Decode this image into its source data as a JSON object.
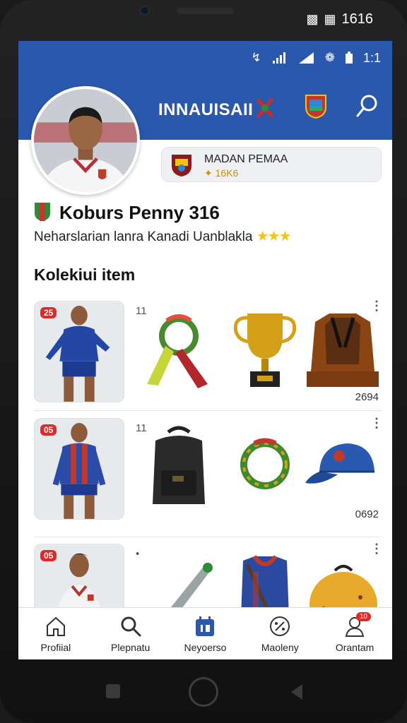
{
  "device": {
    "outer_status": {
      "time": "1616",
      "icons": [
        "photo-icon",
        "sim-icon"
      ]
    },
    "inner_status": {
      "time": "1:1",
      "icons": [
        "bluetooth-icon",
        "signal-icon",
        "signal-icon",
        "settings-icon",
        "battery-icon"
      ]
    }
  },
  "header": {
    "title": "INNAUISAII",
    "icons": [
      "ribbon-badge-icon",
      "club-crest-icon",
      "search-icon"
    ],
    "accent": "#2a58ad"
  },
  "profile": {
    "club_name": "MADAN PEMAA",
    "club_sub": "✦ 16K6",
    "player_name": "Koburs Penny 316",
    "description": "Neharslarian lanra Kanadi Uanblakla",
    "stars": "★★★"
  },
  "collection": {
    "title": "Kolekiui item",
    "rows": [
      {
        "badge": "25",
        "count": "11",
        "value": "2694",
        "items": [
          "scarf-wreath-icon",
          "trophy-icon",
          "jersey-display-icon"
        ]
      },
      {
        "badge": "05",
        "count": "11",
        "value": "0692",
        "items": [
          "backpack-icon",
          "wreath-icon",
          "cap-icon"
        ]
      },
      {
        "badge": "05",
        "count": "•",
        "value": "",
        "items": [
          "bat-icon",
          "jersey-icon",
          "ball-icon"
        ]
      }
    ]
  },
  "nav": {
    "items": [
      {
        "label": "Profiial",
        "icon": "home-icon"
      },
      {
        "label": "Plepnatu",
        "icon": "search-icon"
      },
      {
        "label": "Neyoerso",
        "icon": "calendar-icon"
      },
      {
        "label": "Maoleny",
        "icon": "percent-icon"
      },
      {
        "label": "Orantam",
        "icon": "user-icon",
        "badge": "10"
      }
    ]
  }
}
